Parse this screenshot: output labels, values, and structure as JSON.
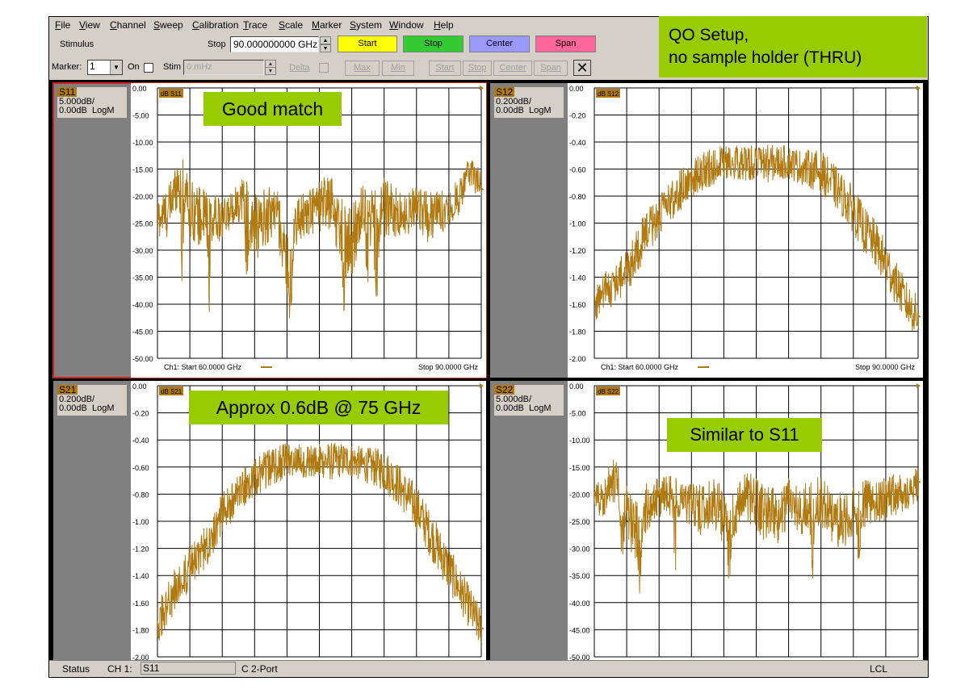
{
  "menu": [
    "File",
    "View",
    "Channel",
    "Sweep",
    "Calibration",
    "Trace",
    "Scale",
    "Marker",
    "System",
    "Window",
    "Help"
  ],
  "toolbar": {
    "stimulus_label": "Stimulus",
    "stop_label": "Stop",
    "stop_value": "90.000000000 GHz",
    "start_btn": "Start",
    "stop_btn": "Stop",
    "center_btn": "Center",
    "span_btn": "Span",
    "colors": {
      "start": "#ffff00",
      "stop": "#33cc33",
      "center": "#9999ff",
      "span": "#ff6699"
    }
  },
  "marker_bar": {
    "marker_label": "Marker:",
    "marker_value": "1",
    "on_label": "On",
    "stim_label": "Stim",
    "stim_value": "0 mHz",
    "delta_label": "Delta",
    "buttons": [
      "Max",
      "Min",
      "Start",
      "Stop",
      "Center",
      "Span"
    ],
    "close_glyph": "✕"
  },
  "notes": {
    "title_line1": "QO Setup,",
    "title_line2": "no sample holder (THRU)",
    "s11": "Good match",
    "s21": "Approx 0.6dB @ 75 GHz",
    "s22": "Similar to S11"
  },
  "chart_data": [
    {
      "type": "line",
      "trace": "S11",
      "scale": "5.000dB/",
      "ref": "0.00dB",
      "format": "LogM",
      "tag": "dB S11",
      "yticks": [
        "0.00",
        "-5.00",
        "-10.00",
        "-15.00",
        "-20.00",
        "-25.00",
        "-30.00",
        "-35.00",
        "-40.00",
        "-45.00",
        "-50.00"
      ],
      "ylim": [
        -50,
        0
      ],
      "xlim": [
        60,
        90
      ],
      "footer_start": "Ch1: Start  60.0000 GHz",
      "footer_stop": "Stop  90.0000 GHz",
      "x": [
        60,
        61,
        62,
        63,
        64,
        65,
        66,
        67,
        68,
        69,
        70,
        71,
        72,
        73,
        74,
        75,
        76,
        77,
        78,
        79,
        80,
        81,
        82,
        83,
        84,
        85,
        86,
        87,
        88,
        89,
        90
      ],
      "y": [
        -24,
        -23,
        -16,
        -22,
        -24,
        -23,
        -25,
        -22,
        -20,
        -26,
        -24,
        -22,
        -33,
        -24,
        -23,
        -22,
        -21,
        -26,
        -29,
        -22,
        -23,
        -22,
        -23,
        -24,
        -21,
        -24,
        -23,
        -22,
        -20,
        -15,
        -19
      ],
      "ripple": [
        5,
        6,
        6,
        7,
        7,
        5,
        5,
        4,
        6,
        8,
        7,
        6,
        7,
        5,
        6,
        6,
        7,
        8,
        9,
        6,
        5,
        7,
        6,
        5,
        5,
        6,
        5,
        5,
        4,
        4,
        4
      ],
      "dips": [
        [
          62.3,
          -38
        ],
        [
          64.8,
          -42
        ],
        [
          68.3,
          -40
        ],
        [
          72.3,
          -46
        ],
        [
          77.3,
          -45
        ],
        [
          79.5,
          -43
        ],
        [
          80.3,
          -50
        ]
      ]
    },
    {
      "type": "line",
      "trace": "S12",
      "scale": "0.200dB/",
      "ref": "0.00dB",
      "format": "LogM",
      "tag": "dB S12",
      "yticks": [
        "0.00",
        "-0.20",
        "-0.40",
        "-0.60",
        "-0.80",
        "-1.00",
        "-1.20",
        "-1.40",
        "-1.60",
        "-1.80",
        "-2.00"
      ],
      "ylim": [
        -2,
        0
      ],
      "xlim": [
        60,
        90
      ],
      "footer_start": "Ch1: Start  60.0000 GHz",
      "footer_stop": "Stop  90.0000 GHz",
      "x": [
        60,
        61,
        62,
        63,
        64,
        65,
        66,
        67,
        68,
        69,
        70,
        71,
        72,
        73,
        74,
        75,
        76,
        77,
        78,
        79,
        80,
        81,
        82,
        83,
        84,
        85,
        86,
        87,
        88,
        89,
        90
      ],
      "y": [
        -1.6,
        -1.5,
        -1.45,
        -1.35,
        -1.2,
        -1.05,
        -0.95,
        -0.85,
        -0.75,
        -0.68,
        -0.62,
        -0.58,
        -0.55,
        -0.55,
        -0.56,
        -0.55,
        -0.56,
        -0.55,
        -0.55,
        -0.58,
        -0.6,
        -0.62,
        -0.7,
        -0.8,
        -0.9,
        -1.05,
        -1.15,
        -1.3,
        -1.45,
        -1.6,
        -1.7
      ],
      "ripple": [
        0.18,
        0.2,
        0.2,
        0.22,
        0.22,
        0.2,
        0.2,
        0.18,
        0.2,
        0.18,
        0.18,
        0.18,
        0.16,
        0.16,
        0.16,
        0.16,
        0.18,
        0.16,
        0.16,
        0.16,
        0.18,
        0.2,
        0.2,
        0.2,
        0.22,
        0.22,
        0.22,
        0.22,
        0.2,
        0.2,
        0.2
      ],
      "dips": []
    },
    {
      "type": "line",
      "trace": "S21",
      "scale": "0.200dB/",
      "ref": "0.00dB",
      "format": "LogM",
      "tag": "dB S21",
      "yticks": [
        "0.00",
        "-0.20",
        "-0.40",
        "-0.60",
        "-0.80",
        "-1.00",
        "-1.20",
        "-1.40",
        "-1.60",
        "-1.80",
        "-2.00"
      ],
      "ylim": [
        -2,
        0
      ],
      "xlim": [
        60,
        90
      ],
      "x": [
        60,
        61,
        62,
        63,
        64,
        65,
        66,
        67,
        68,
        69,
        70,
        71,
        72,
        73,
        74,
        75,
        76,
        77,
        78,
        79,
        80,
        81,
        82,
        83,
        84,
        85,
        86,
        87,
        88,
        89,
        90
      ],
      "y": [
        -1.75,
        -1.6,
        -1.45,
        -1.35,
        -1.25,
        -1.1,
        -0.95,
        -0.85,
        -0.75,
        -0.68,
        -0.62,
        -0.58,
        -0.55,
        -0.55,
        -0.56,
        -0.55,
        -0.56,
        -0.55,
        -0.55,
        -0.58,
        -0.6,
        -0.62,
        -0.7,
        -0.8,
        -0.9,
        -1.05,
        -1.2,
        -1.35,
        -1.5,
        -1.65,
        -1.8
      ],
      "ripple": [
        0.2,
        0.2,
        0.2,
        0.22,
        0.22,
        0.2,
        0.2,
        0.18,
        0.2,
        0.18,
        0.18,
        0.18,
        0.16,
        0.16,
        0.16,
        0.16,
        0.18,
        0.16,
        0.16,
        0.16,
        0.18,
        0.2,
        0.2,
        0.2,
        0.22,
        0.22,
        0.22,
        0.22,
        0.2,
        0.2,
        0.2
      ],
      "dips": []
    },
    {
      "type": "line",
      "trace": "S22",
      "scale": "5.000dB/",
      "ref": "0.00dB",
      "format": "LogM",
      "tag": "dB S22",
      "yticks": [
        "0.00",
        "-5.00",
        "-10.00",
        "-15.00",
        "-20.00",
        "-25.00",
        "-30.00",
        "-35.00",
        "-40.00",
        "-45.00",
        "-50.00"
      ],
      "ylim": [
        -50,
        0
      ],
      "xlim": [
        60,
        90
      ],
      "x": [
        60,
        61,
        62,
        63,
        64,
        65,
        66,
        67,
        68,
        69,
        70,
        71,
        72,
        73,
        74,
        75,
        76,
        77,
        78,
        79,
        80,
        81,
        82,
        83,
        84,
        85,
        86,
        87,
        88,
        89,
        90
      ],
      "y": [
        -21,
        -20,
        -17,
        -24,
        -27,
        -22,
        -21,
        -20,
        -21,
        -22,
        -23,
        -21,
        -24,
        -23,
        -20,
        -22,
        -24,
        -25,
        -21,
        -23,
        -22,
        -21,
        -24,
        -25,
        -23,
        -22,
        -21,
        -21,
        -20,
        -20,
        -18
      ],
      "ripple": [
        4,
        5,
        6,
        7,
        7,
        6,
        5,
        5,
        5,
        5,
        6,
        6,
        7,
        6,
        6,
        6,
        7,
        7,
        6,
        6,
        6,
        6,
        6,
        7,
        6,
        6,
        5,
        5,
        5,
        4,
        4
      ],
      "dips": [
        [
          62.6,
          -35
        ],
        [
          64.2,
          -40
        ],
        [
          67.5,
          -37
        ],
        [
          72.5,
          -39
        ],
        [
          80.2,
          -37
        ],
        [
          84.5,
          -36
        ]
      ]
    }
  ],
  "status": {
    "label": "Status",
    "ch": "CH 1:",
    "trace": "S11",
    "cal": "C  2-Port",
    "lcl": "LCL"
  },
  "colors": {
    "trace": "#b07a10",
    "grid_bg": "#ffffff",
    "panel": "#808080",
    "note_bg": "#99cc00"
  }
}
